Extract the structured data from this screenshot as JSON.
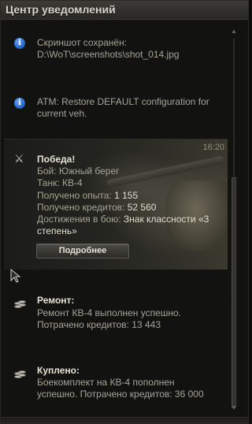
{
  "window": {
    "title": "Центр уведомлений"
  },
  "notifications": {
    "screenshot": {
      "icon": "info-icon",
      "line1": "Скриншот сохранён:",
      "line2": "D:\\WoT\\screenshots\\shot_014.jpg"
    },
    "atm": {
      "icon": "info-icon",
      "line1": "ATM: Restore DEFAULT configuration for",
      "line2": "current veh."
    },
    "victory": {
      "icon": "crossed-swords-icon",
      "time": "16:20",
      "title": "Победа!",
      "battle": "Бой: Южный берег",
      "tank": "Танк: КВ-4",
      "xp_label": "Получено опыта: ",
      "xp_value": "1 155",
      "credits_label": "Получено кредитов: ",
      "credits_value": "52 560",
      "achievements_label": "Достижения в бою: ",
      "achievements_value": "Знак классности «3",
      "achievements_value2": "степень»",
      "details_button": "Подробнее"
    },
    "repair": {
      "icon": "credits-coins-icon",
      "title": "Ремонт:",
      "line1": "Ремонт КВ-4 выполнен успешно.",
      "line2": "Потрачено кредитов:  13 443"
    },
    "purchase": {
      "icon": "credits-coins-icon",
      "title": "Куплено:",
      "line1": "Боекомплект на КВ-4 пополнен",
      "line2": "успешно. Потрачено кредитов:  36 000"
    }
  },
  "colors": {
    "title_text": "#d6d3c8",
    "body_text": "#a7a498",
    "highlight_text": "#e2ddcd",
    "info_blue": "#1f5fbf"
  }
}
